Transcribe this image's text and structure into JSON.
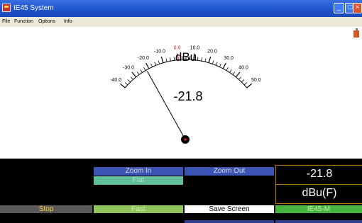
{
  "window": {
    "title": "IE45 System"
  },
  "menu": [
    "File",
    "Function",
    "Options",
    "Info"
  ],
  "meter": {
    "unit": "dBu",
    "value_text": "-21.8",
    "value": -21.8,
    "scale_min": -40,
    "scale_max": 50,
    "tick_labels": [
      "-40.0",
      "-30.0",
      "-20.0",
      "-10.0",
      "0.0",
      "10.0",
      "20.0",
      "30.0",
      "40.0",
      "50.0"
    ]
  },
  "controls": {
    "zoom_in": "Zoom In",
    "zoom_out": "Zoom Out",
    "flat": "Flat",
    "stop": "Stop",
    "fast": "Fast",
    "save_screen": "Save Screen",
    "device": "IE45-M"
  },
  "readout": {
    "value": "-21.8",
    "unit": "dBu(F)"
  },
  "colors": {
    "zoom_btn": "#3b53b5",
    "flat_btn": "#5fbf9a",
    "stop_btn": "#595959",
    "fast_btn": "#8fc45a",
    "device_btn": "#47b53f",
    "zero_tick": "#d0191b",
    "readout_border": "#c07a00"
  }
}
